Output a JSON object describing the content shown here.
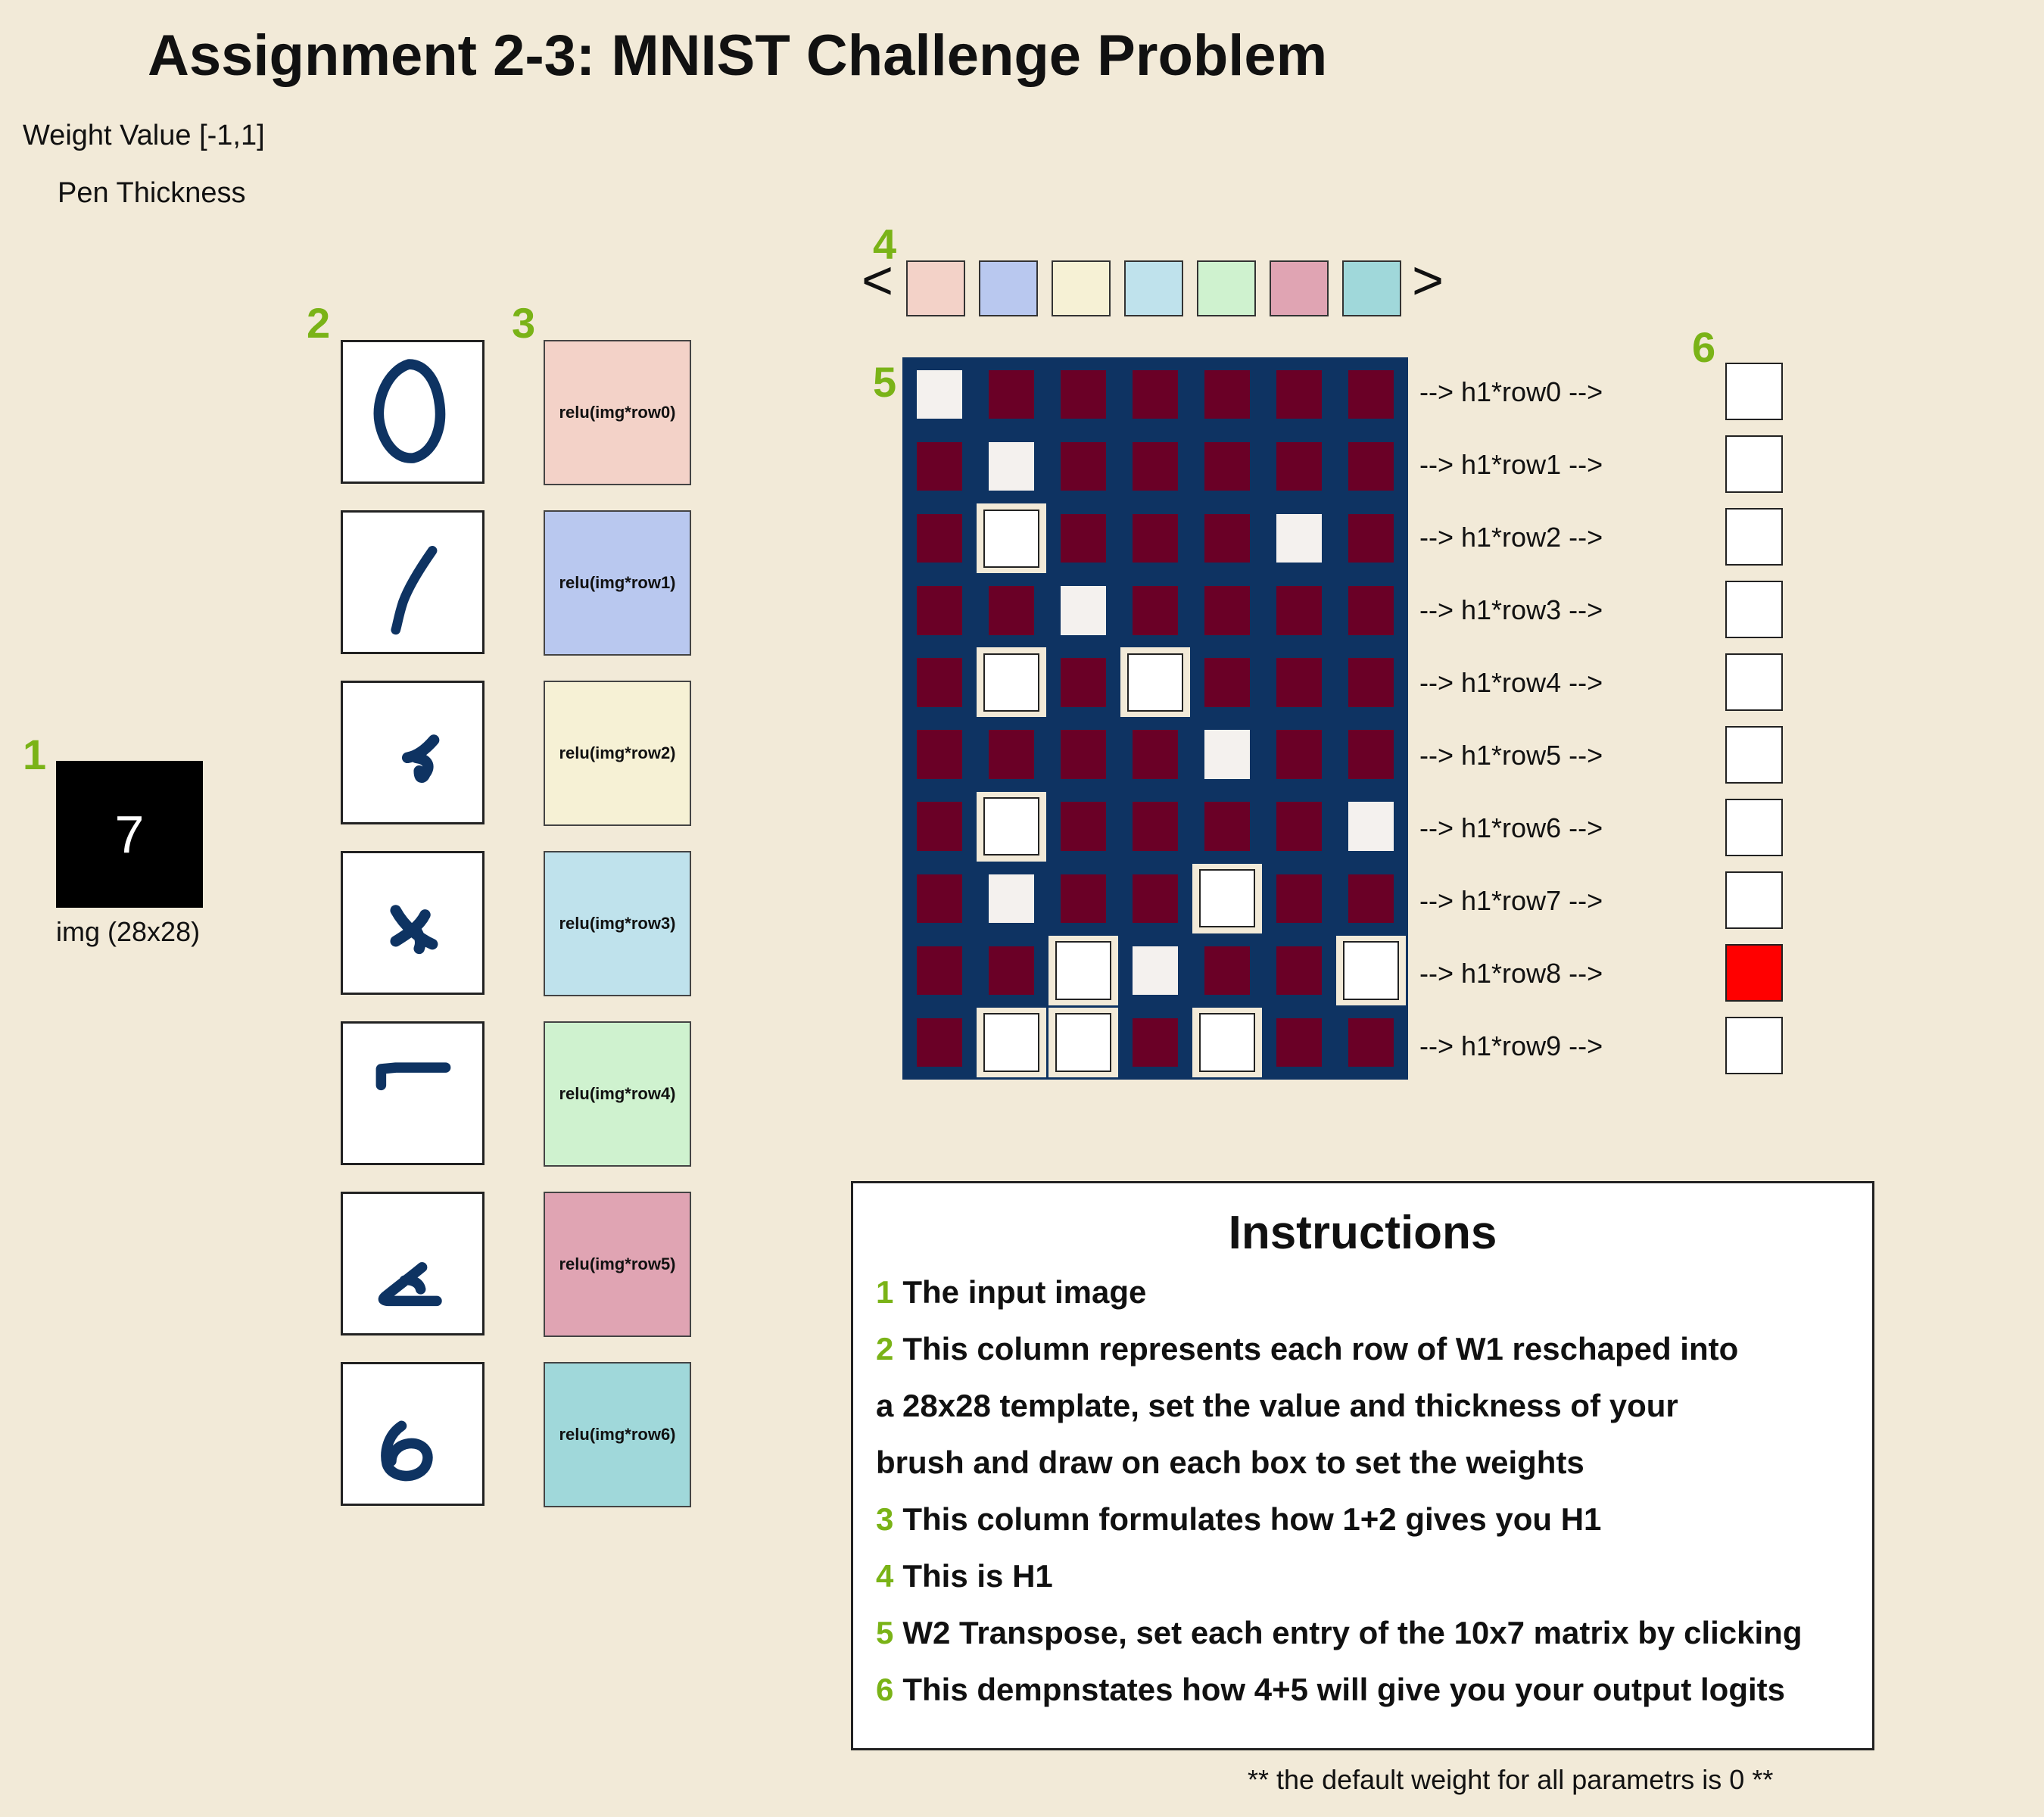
{
  "title": "Assignment 2-3: MNIST Challenge Problem",
  "controls": {
    "weight_value_label": "Weight Value [-1,1]",
    "pen_thickness_label": "Pen Thickness"
  },
  "markers": [
    "1",
    "2",
    "3",
    "4",
    "5",
    "6"
  ],
  "input_image": {
    "digit": "7",
    "caption": "img (28x28)"
  },
  "templates": [
    "0",
    "1",
    "2",
    "3",
    "4",
    "5",
    "6"
  ],
  "relu_labels": [
    "relu(img*row0)",
    "relu(img*row1)",
    "relu(img*row2)",
    "relu(img*row3)",
    "relu(img*row4)",
    "relu(img*row5)",
    "relu(img*row6)"
  ],
  "colors": {
    "h1": [
      "#f3d2c8",
      "#b9c8ef",
      "#f6f1d5",
      "#bfe2ec",
      "#cff2cf",
      "#e0a4b3",
      "#a0d8da"
    ],
    "grid_bg": "#0e3362",
    "negative_weight": "#6a0026",
    "accent_marker": "#7ab317",
    "hot_logit": "#ff0000"
  },
  "h1_nav": {
    "prev": "<",
    "next": ">"
  },
  "w2_transpose": [
    [
      1,
      0,
      0,
      0,
      0,
      0,
      0
    ],
    [
      0,
      1,
      0,
      0,
      0,
      0,
      0
    ],
    [
      0,
      2,
      0,
      0,
      0,
      1,
      0
    ],
    [
      0,
      0,
      1,
      0,
      0,
      0,
      0
    ],
    [
      0,
      2,
      0,
      2,
      0,
      0,
      0
    ],
    [
      0,
      0,
      0,
      0,
      1,
      0,
      0
    ],
    [
      0,
      2,
      0,
      0,
      0,
      0,
      1
    ],
    [
      0,
      1,
      0,
      0,
      2,
      0,
      0
    ],
    [
      0,
      0,
      2,
      1,
      0,
      0,
      2
    ],
    [
      0,
      2,
      2,
      0,
      2,
      0,
      0
    ]
  ],
  "row_labels": [
    "--> h1*row0 -->",
    "--> h1*row1 -->",
    "--> h1*row2 -->",
    "--> h1*row3 -->",
    "--> h1*row4 -->",
    "--> h1*row5 -->",
    "--> h1*row6 -->",
    "--> h1*row7 -->",
    "--> h1*row8 -->",
    "--> h1*row9 -->"
  ],
  "logits_active_index": 8,
  "instructions": {
    "title": "Instructions",
    "lines": [
      {
        "num": "1",
        "text": "The input image"
      },
      {
        "num": "2",
        "text": "This column represents each row of W1 reschaped into"
      },
      {
        "num": "",
        "text": "a 28x28 template, set the value and thickness of your"
      },
      {
        "num": "",
        "text": "brush and draw on each box to set the weights"
      },
      {
        "num": "3",
        "text": "This column formulates how 1+2 gives you H1"
      },
      {
        "num": "4",
        "text": "This is H1"
      },
      {
        "num": "5",
        "text": "W2 Transpose, set each entry of the 10x7 matrix by clicking"
      },
      {
        "num": "6",
        "text": "This dempnstates how 4+5 will give you your output logits"
      }
    ]
  },
  "footnote": "** the default weight for all parametrs is 0 **"
}
